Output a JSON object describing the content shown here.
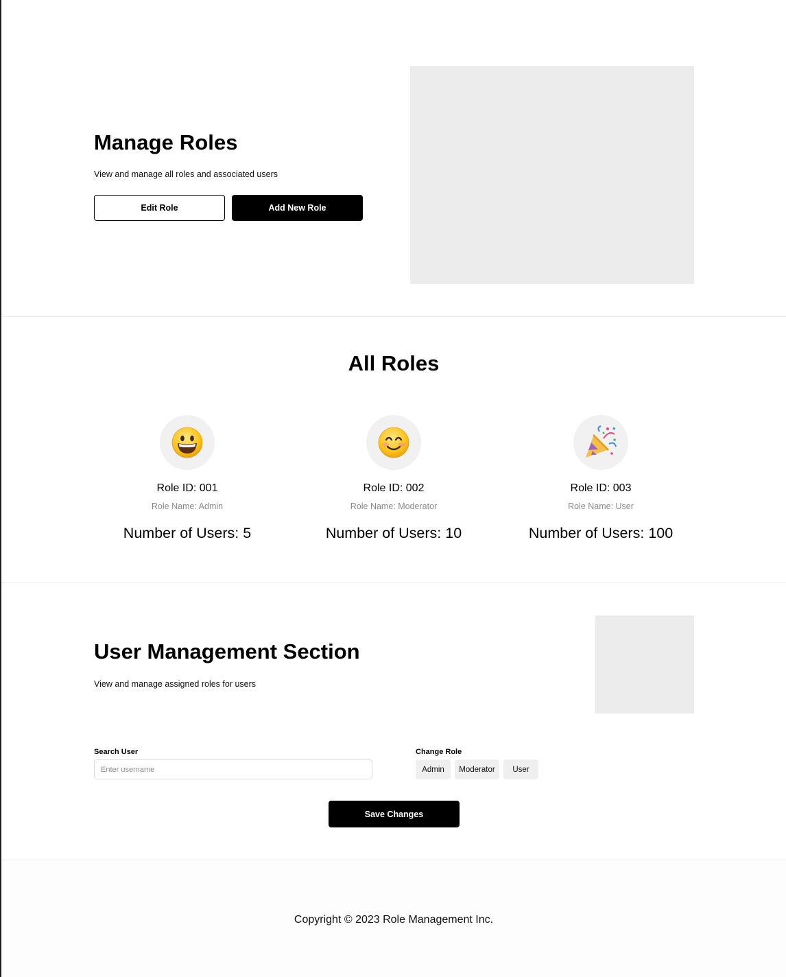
{
  "hero": {
    "title": "Manage Roles",
    "subtitle": "View and manage all roles and associated users",
    "edit_button": "Edit Role",
    "add_button": "Add New Role"
  },
  "roles_section": {
    "title": "All Roles",
    "roles": [
      {
        "emoji": "smiley-face",
        "id_text": "Role ID: 001",
        "name_text": "Role Name: Admin",
        "users_text": "Number of Users: 5"
      },
      {
        "emoji": "smiling-face",
        "id_text": "Role ID: 002",
        "name_text": "Role Name: Moderator",
        "users_text": "Number of Users: 10"
      },
      {
        "emoji": "party-popper",
        "id_text": "Role ID: 003",
        "name_text": "Role Name: User",
        "users_text": "Number of Users: 100"
      }
    ]
  },
  "user_management": {
    "title": "User Management Section",
    "subtitle": "View and manage assigned roles for users",
    "search_label": "Search User",
    "search_placeholder": "Enter username",
    "search_value": "",
    "change_role_label": "Change Role",
    "role_options": [
      "Admin",
      "Moderator",
      "User"
    ],
    "save_button": "Save Changes"
  },
  "footer": {
    "copyright": "Copyright © 2023 Role Management Inc."
  }
}
